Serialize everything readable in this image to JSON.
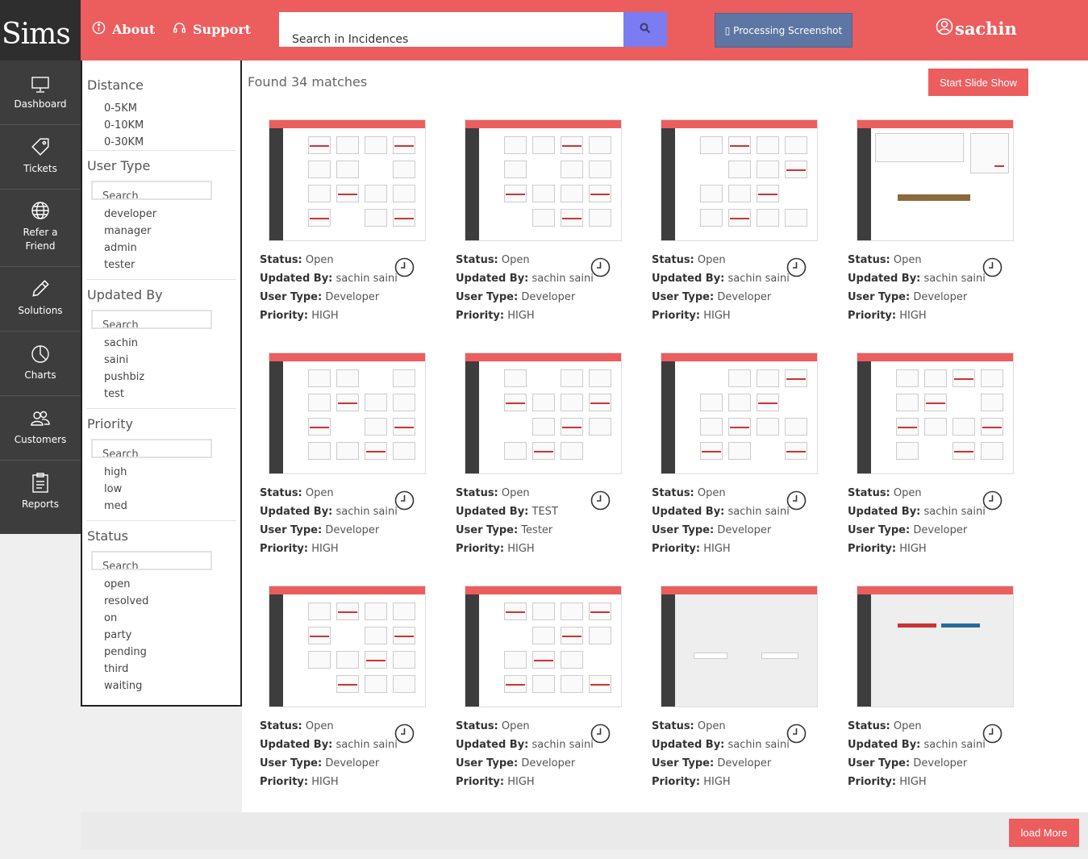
{
  "app": {
    "logo": "Sims"
  },
  "header": {
    "about_label": "About",
    "support_label": "Support",
    "search_placeholder": "Search in Incidences",
    "processing_label": "▯ Processing Screenshot",
    "user_name": "sachin"
  },
  "sidebar": {
    "items": [
      {
        "label": "Dashboard",
        "icon": "monitor-icon"
      },
      {
        "label": "Tickets",
        "icon": "tag-icon"
      },
      {
        "label": "Refer a Friend",
        "icon": "globe-icon"
      },
      {
        "label": "Solutions",
        "icon": "pencil-icon"
      },
      {
        "label": "Charts",
        "icon": "pie-chart-icon"
      },
      {
        "label": "Customers",
        "icon": "users-icon"
      },
      {
        "label": "Reports",
        "icon": "clipboard-icon"
      }
    ]
  },
  "filters": {
    "distance": {
      "title": "Distance",
      "options": [
        "0-5KM",
        "0-10KM",
        "0-30KM"
      ]
    },
    "user_type": {
      "title": "User Type",
      "search_placeholder": "Search",
      "options": [
        "developer",
        "manager",
        "admin",
        "tester"
      ]
    },
    "updated_by": {
      "title": "Updated By",
      "search_placeholder": "Search",
      "options": [
        "sachin",
        "saini",
        "pushbiz",
        "test"
      ]
    },
    "priority": {
      "title": "Priority",
      "search_placeholder": "Search",
      "options": [
        "high",
        "low",
        "med"
      ]
    },
    "status": {
      "title": "Status",
      "search_placeholder": "Search",
      "options": [
        "open",
        "resolved",
        "on",
        "party",
        "pending",
        "third",
        "waiting"
      ]
    }
  },
  "results": {
    "found_text": "Found 34 matches",
    "slideshow_label": "Start Slide Show",
    "labels": {
      "status": "Status:",
      "updated_by": "Updated By:",
      "user_type": "User Type:",
      "priority": "Priority:"
    },
    "cards": [
      {
        "status": "Open",
        "updated_by": "sachin saini",
        "user_type": "Developer",
        "priority": "HIGH",
        "thumb": "grid"
      },
      {
        "status": "Open",
        "updated_by": "sachin saini",
        "user_type": "Developer",
        "priority": "HIGH",
        "thumb": "grid"
      },
      {
        "status": "Open",
        "updated_by": "sachin saini",
        "user_type": "Developer",
        "priority": "HIGH",
        "thumb": "grid"
      },
      {
        "status": "Open",
        "updated_by": "sachin saini",
        "user_type": "Developer",
        "priority": "HIGH",
        "thumb": "form"
      },
      {
        "status": "Open",
        "updated_by": "sachin saini",
        "user_type": "Developer",
        "priority": "HIGH",
        "thumb": "grid"
      },
      {
        "status": "Open",
        "updated_by": "TEST",
        "user_type": "Tester",
        "priority": "HIGH",
        "thumb": "grid"
      },
      {
        "status": "Open",
        "updated_by": "sachin saini",
        "user_type": "Developer",
        "priority": "HIGH",
        "thumb": "grid"
      },
      {
        "status": "Open",
        "updated_by": "sachin saini",
        "user_type": "Developer",
        "priority": "HIGH",
        "thumb": "grid"
      },
      {
        "status": "Open",
        "updated_by": "sachin saini",
        "user_type": "Developer",
        "priority": "HIGH",
        "thumb": "grid"
      },
      {
        "status": "Open",
        "updated_by": "sachin saini",
        "user_type": "Developer",
        "priority": "HIGH",
        "thumb": "grid"
      },
      {
        "status": "Open",
        "updated_by": "sachin saini",
        "user_type": "Developer",
        "priority": "HIGH",
        "thumb": "blank"
      },
      {
        "status": "Open",
        "updated_by": "sachin saini",
        "user_type": "Developer",
        "priority": "HIGH",
        "thumb": "refer"
      }
    ],
    "load_more_label": "load More"
  },
  "colors": {
    "accent": "#ec5d5e",
    "sidebar": "#3d3d3d",
    "search_button": "#7c7cf2",
    "processing": "#5d76a3"
  }
}
